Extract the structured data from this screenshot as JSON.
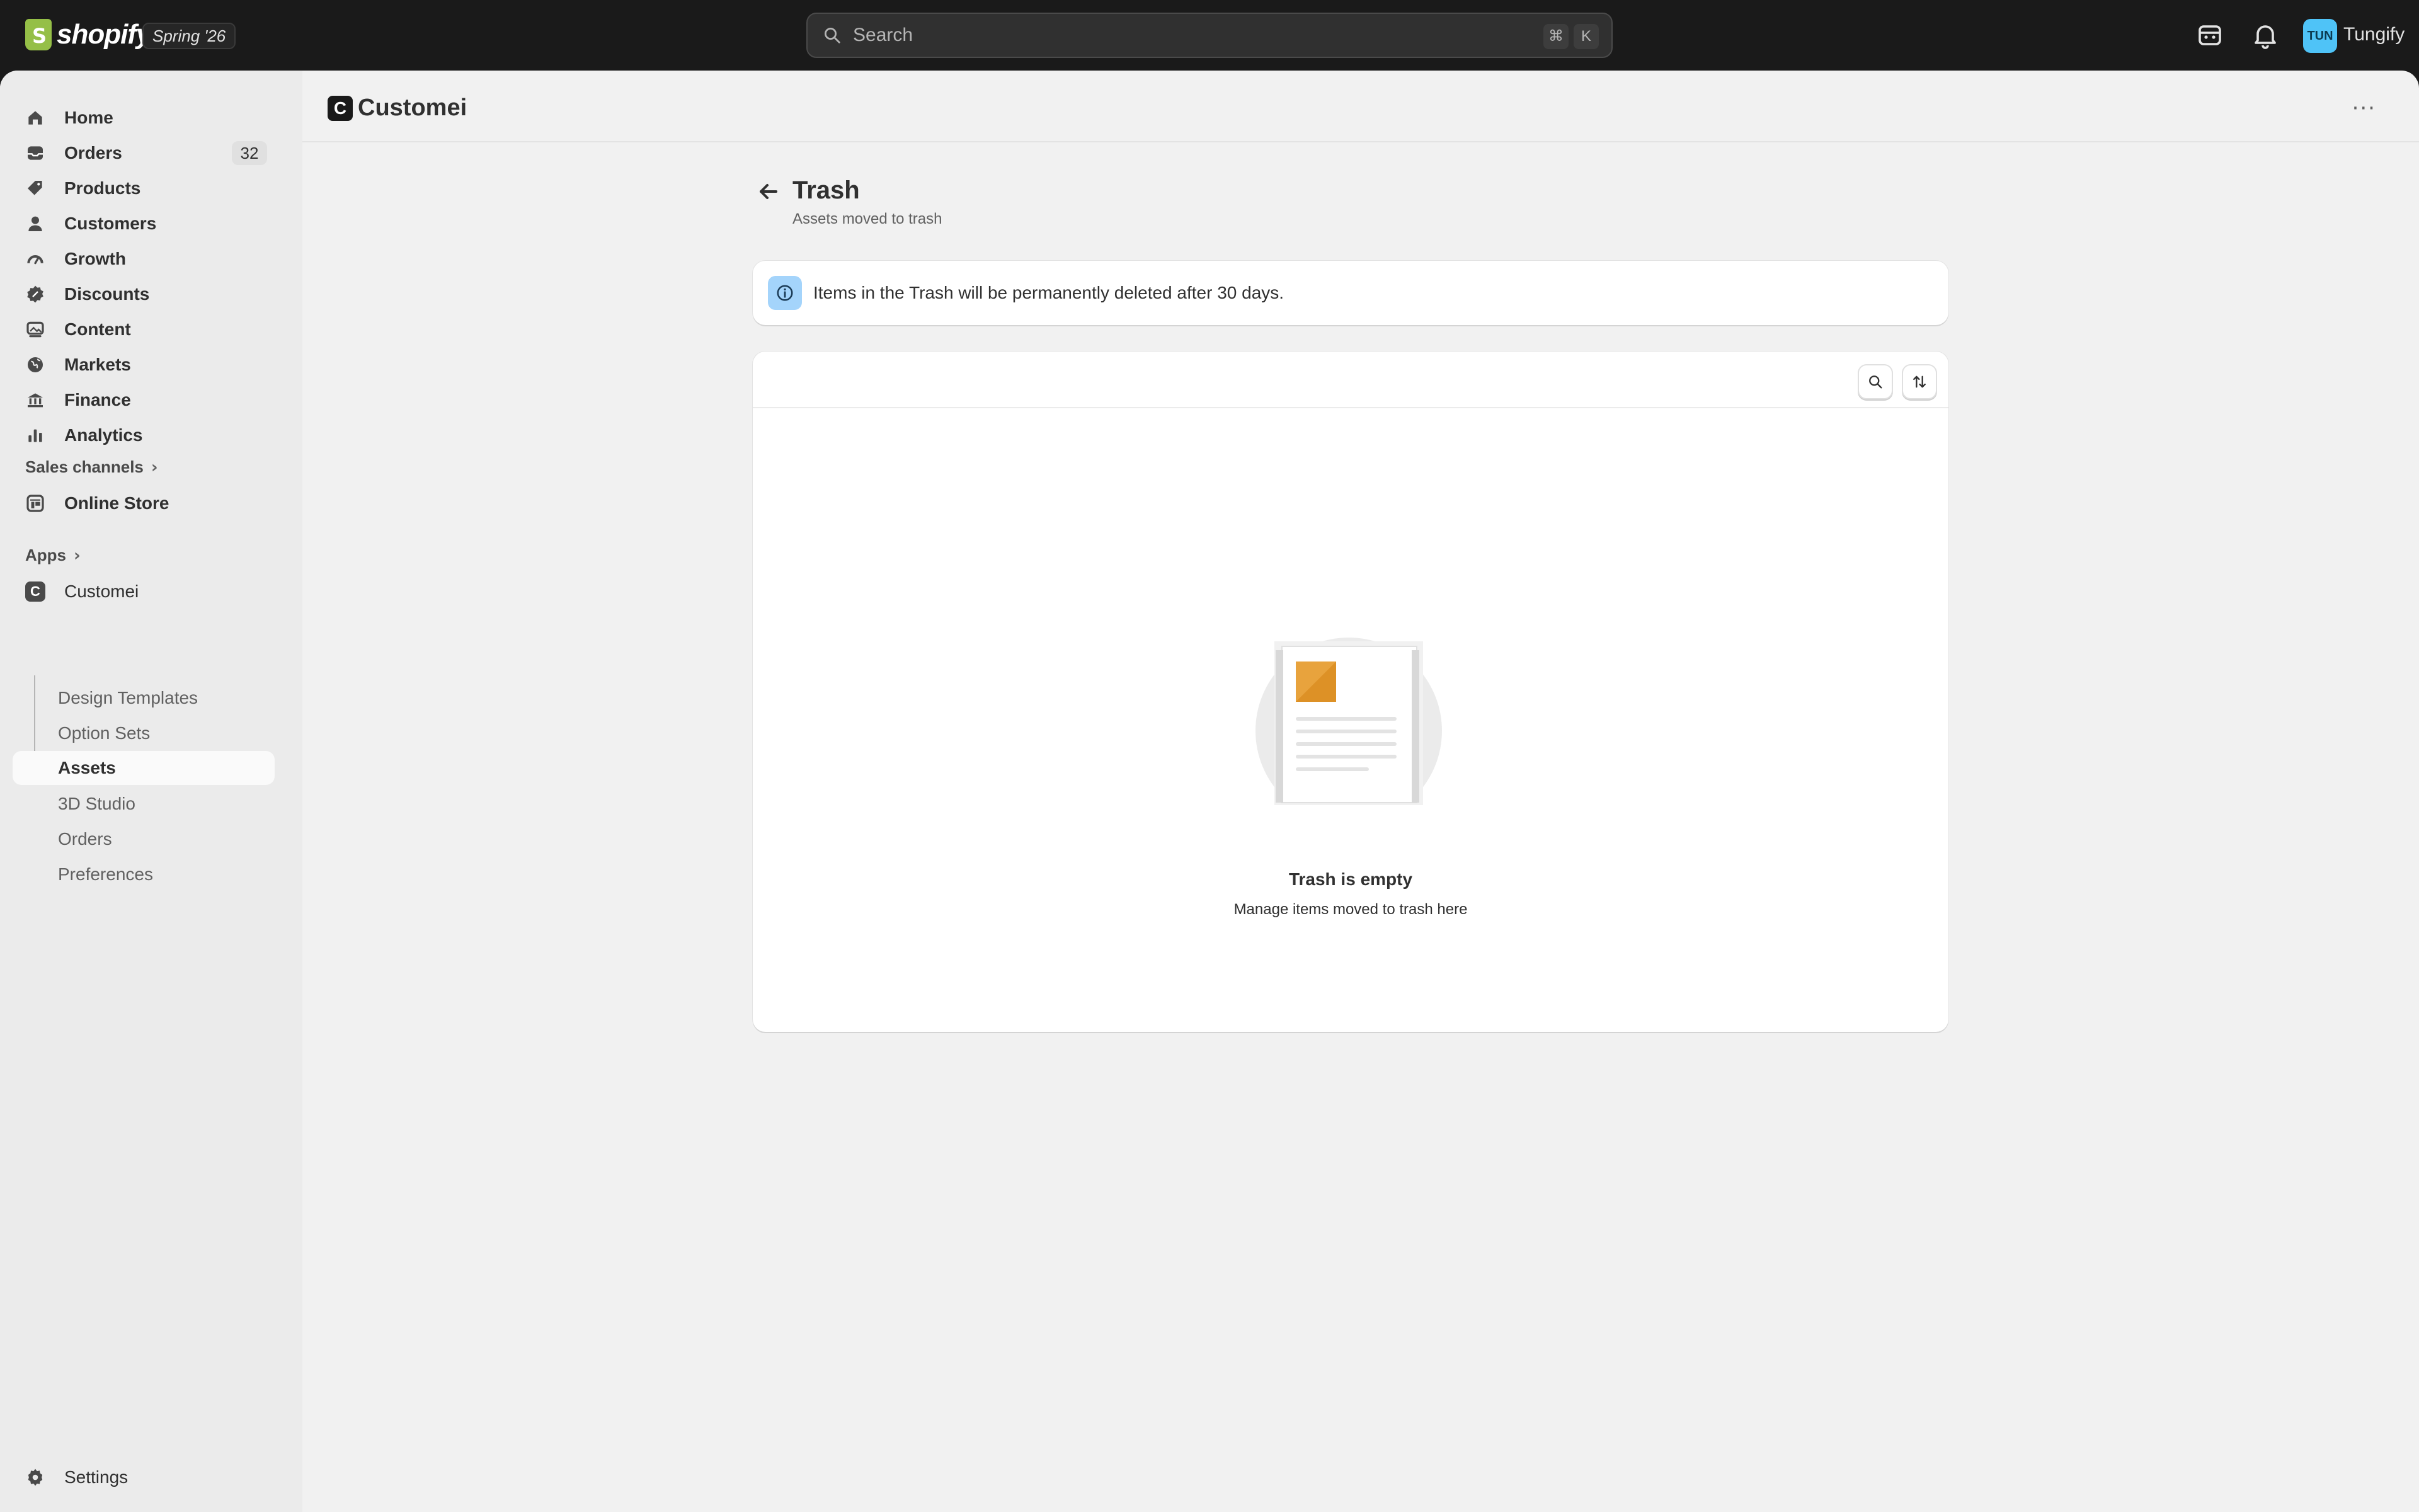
{
  "topbar": {
    "brand": "shopify",
    "edition": "Spring '26",
    "search_placeholder": "Search",
    "shortcut_key1": "⌘",
    "shortcut_key2": "K",
    "avatar_initials": "TUN",
    "store_name": "Tungify"
  },
  "sidebar": {
    "items": [
      {
        "label": "Home",
        "icon": "home-icon"
      },
      {
        "label": "Orders",
        "icon": "orders-icon",
        "count": "32"
      },
      {
        "label": "Products",
        "icon": "tag-icon"
      },
      {
        "label": "Customers",
        "icon": "person-icon"
      },
      {
        "label": "Growth",
        "icon": "gauge-icon"
      },
      {
        "label": "Discounts",
        "icon": "discount-icon"
      },
      {
        "label": "Content",
        "icon": "image-icon"
      },
      {
        "label": "Markets",
        "icon": "globe-icon"
      },
      {
        "label": "Finance",
        "icon": "bank-icon"
      },
      {
        "label": "Analytics",
        "icon": "bar-chart-icon"
      }
    ],
    "sales_channels_label": "Sales channels",
    "online_store_label": "Online Store",
    "apps_label": "Apps",
    "app_name": "Customei",
    "app_badge": "C",
    "app_subitems": [
      "Design Templates",
      "Option Sets",
      "Assets",
      "3D Studio",
      "Orders",
      "Preferences"
    ],
    "active_subitem": "Assets",
    "settings_label": "Settings"
  },
  "header": {
    "app_logo": "C",
    "app_title": "Customei",
    "more": "···"
  },
  "page": {
    "title": "Trash",
    "subtitle": "Assets moved to trash",
    "banner_text": "Items in the Trash will be permanently deleted after 30 days.",
    "empty_title": "Trash is empty",
    "empty_subtitle": "Manage items moved to trash here"
  },
  "colors": {
    "accent_orange": "#e8a33d",
    "info_blue": "#a4d4fb",
    "avatar_blue": "#4fc3f7",
    "topbar_bg": "#1a1a1a"
  }
}
